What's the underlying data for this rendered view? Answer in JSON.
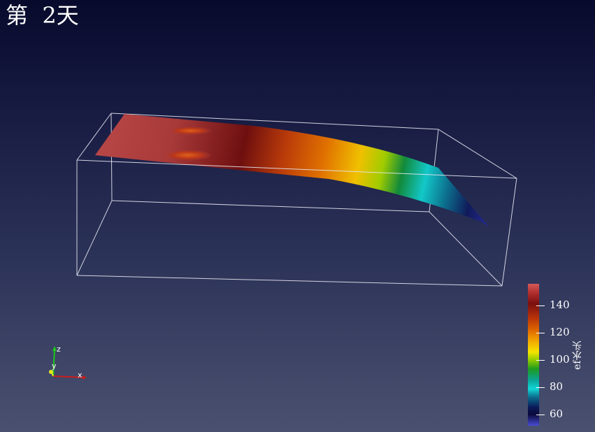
{
  "title": "第  2天",
  "colorbar": {
    "title": "ef水头",
    "ticks": [
      "140",
      "120",
      "100",
      "80",
      "60"
    ]
  },
  "axes": {
    "x": "x",
    "y": "y",
    "z": "z"
  },
  "colors": {
    "bg_top": "#070a2c",
    "bg_bottom": "#4a5170",
    "box_edges": "#e6e6f0",
    "high": "#8b1a1a",
    "mid": "#f5e400",
    "low": "#0a1a5a"
  }
}
